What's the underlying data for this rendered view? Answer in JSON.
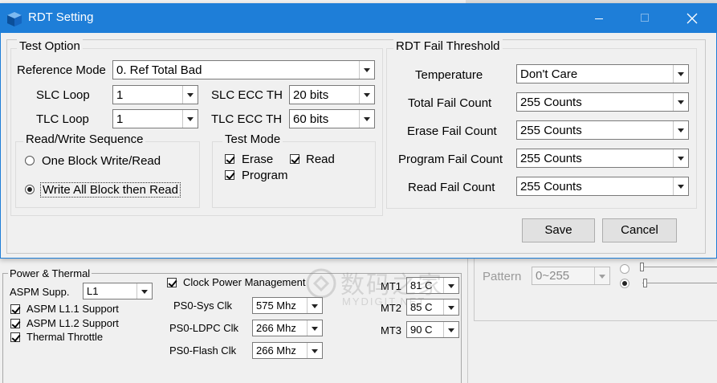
{
  "dialog": {
    "title": "RDT Setting",
    "colors": {
      "titlebar": "#1e7ed8",
      "accent": "#0078d7"
    },
    "test_option": {
      "title": "Test Option",
      "reference_mode_label": "Reference Mode",
      "reference_mode_value": "0. Ref Total Bad",
      "slc_loop_label": "SLC Loop",
      "slc_loop_value": "1",
      "tlc_loop_label": "TLC Loop",
      "tlc_loop_value": "1",
      "slc_ecc_label": "SLC ECC TH",
      "slc_ecc_value": "20 bits",
      "tlc_ecc_label": "TLC ECC TH",
      "tlc_ecc_value": "60 bits",
      "rw_sequence": {
        "title": "Read/Write Sequence",
        "option1": "One Block Write/Read",
        "option2": "Write All Block then Read",
        "selected": 2
      },
      "test_mode": {
        "title": "Test Mode",
        "erase": "Erase",
        "read": "Read",
        "program": "Program",
        "erase_checked": true,
        "read_checked": true,
        "program_checked": true
      }
    },
    "fail_threshold": {
      "title": "RDT Fail Threshold",
      "rows": [
        {
          "label": "Temperature",
          "value": "Don't Care"
        },
        {
          "label": "Total Fail Count",
          "value": "255 Counts"
        },
        {
          "label": "Erase Fail Count",
          "value": "255 Counts"
        },
        {
          "label": "Program Fail Count",
          "value": "255 Counts"
        },
        {
          "label": "Read Fail Count",
          "value": "255 Counts"
        }
      ]
    },
    "save_label": "Save",
    "cancel_label": "Cancel"
  },
  "background": {
    "power_thermal_title": "Power & Thermal",
    "aspm_label": "ASPM Supp.",
    "aspm_value": "L1",
    "aspm_l11": "ASPM L1.1 Support",
    "aspm_l12": "ASPM L1.2 Support",
    "thermal_throttle": "Thermal Throttle",
    "clock_pm": "Clock Power Management",
    "ps0_sys_label": "PS0-Sys Clk",
    "ps0_sys_value": "575 Mhz",
    "ps0_ldpc_label": "PS0-LDPC Clk",
    "ps0_ldpc_value": "266 Mhz",
    "ps0_flash_label": "PS0-Flash Clk",
    "ps0_flash_value": "266 Mhz",
    "mt1_label": "MT1",
    "mt1_value": "81 C",
    "mt2_label": "MT2",
    "mt2_value": "85 C",
    "mt3_label": "MT3",
    "mt3_value": "90 C",
    "pattern_label": "Pattern",
    "pattern_value": "0~255",
    "watermark": "数码之家",
    "watermark_sub": "MYDIGIT.NET"
  }
}
